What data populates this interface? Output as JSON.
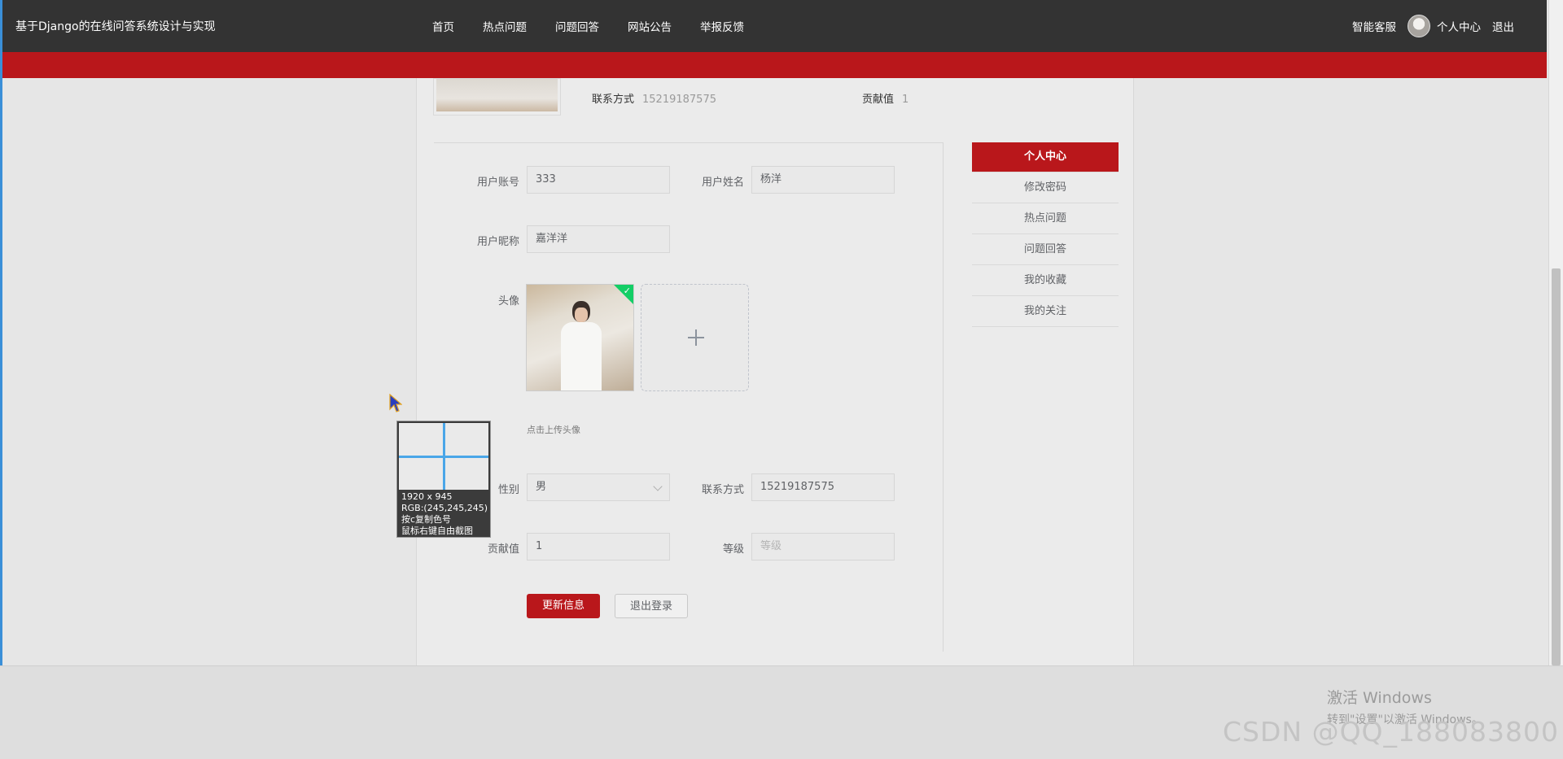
{
  "app": {
    "title": "基于Django的在线问答系统设计与实现"
  },
  "nav": {
    "items": [
      "首页",
      "热点问题",
      "问题回答",
      "网站公告",
      "举报反馈"
    ],
    "right": {
      "service": "智能客服",
      "profile": "个人中心",
      "logout": "退出"
    }
  },
  "profile_header": {
    "contact_label": "联系方式",
    "contact_value": "15219187575",
    "contribution_label": "贡献值",
    "contribution_value": "1"
  },
  "form": {
    "account": {
      "label": "用户账号",
      "value": "333"
    },
    "name": {
      "label": "用户姓名",
      "value": "杨洋"
    },
    "nickname": {
      "label": "用户昵称",
      "value": "嘉洋洋"
    },
    "avatar": {
      "label": "头像",
      "hint": "点击上传头像"
    },
    "gender": {
      "label": "性别",
      "value": "男"
    },
    "contact": {
      "label": "联系方式",
      "value": "15219187575"
    },
    "contribution": {
      "label": "贡献值",
      "value": "1"
    },
    "level": {
      "label": "等级",
      "placeholder": "等级"
    },
    "update_button": "更新信息",
    "logout_button": "退出登录"
  },
  "side_menu": {
    "items": [
      "个人中心",
      "修改密码",
      "热点问题",
      "问题回答",
      "我的收藏",
      "我的关注"
    ],
    "active_index": 0
  },
  "overlay": {
    "magnifier_lines": [
      "1920 x 945",
      "RGB:(245,245,245)",
      "按c复制色号",
      "鼠标右键自由截图"
    ]
  },
  "watermark": {
    "windows_title": "激活 Windows",
    "windows_sub": "转到\"设置\"以激活 Windows。",
    "csdn": "CSDN @QQ_188083800"
  },
  "colors": {
    "navbar": "#333333",
    "accent_red": "#b9171b",
    "success_green": "#13ce66"
  }
}
